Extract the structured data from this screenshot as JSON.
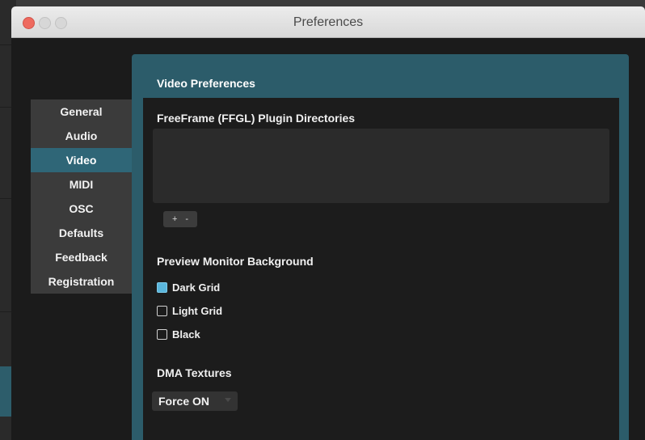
{
  "window": {
    "title": "Preferences"
  },
  "sidebar": {
    "items": [
      {
        "label": "General",
        "active": false
      },
      {
        "label": "Audio",
        "active": false
      },
      {
        "label": "Video",
        "active": true
      },
      {
        "label": "MIDI",
        "active": false
      },
      {
        "label": "OSC",
        "active": false
      },
      {
        "label": "Defaults",
        "active": false
      },
      {
        "label": "Feedback",
        "active": false
      },
      {
        "label": "Registration",
        "active": false
      }
    ]
  },
  "panel": {
    "title": "Video Preferences",
    "plugins": {
      "label": "FreeFrame (FFGL) Plugin Directories",
      "add_label": "+",
      "remove_label": "-"
    },
    "preview_background": {
      "label": "Preview Monitor Background",
      "options": [
        {
          "label": "Dark Grid",
          "checked": true
        },
        {
          "label": "Light Grid",
          "checked": false
        },
        {
          "label": "Black",
          "checked": false
        }
      ]
    },
    "dma_textures": {
      "label": "DMA Textures",
      "selected": "Force ON"
    }
  },
  "colors": {
    "accent": "#2c5c6a",
    "sidebar_active": "#2f6677",
    "checkbox_checked": "#5ab6dc",
    "close_button": "#ee6a5f"
  }
}
